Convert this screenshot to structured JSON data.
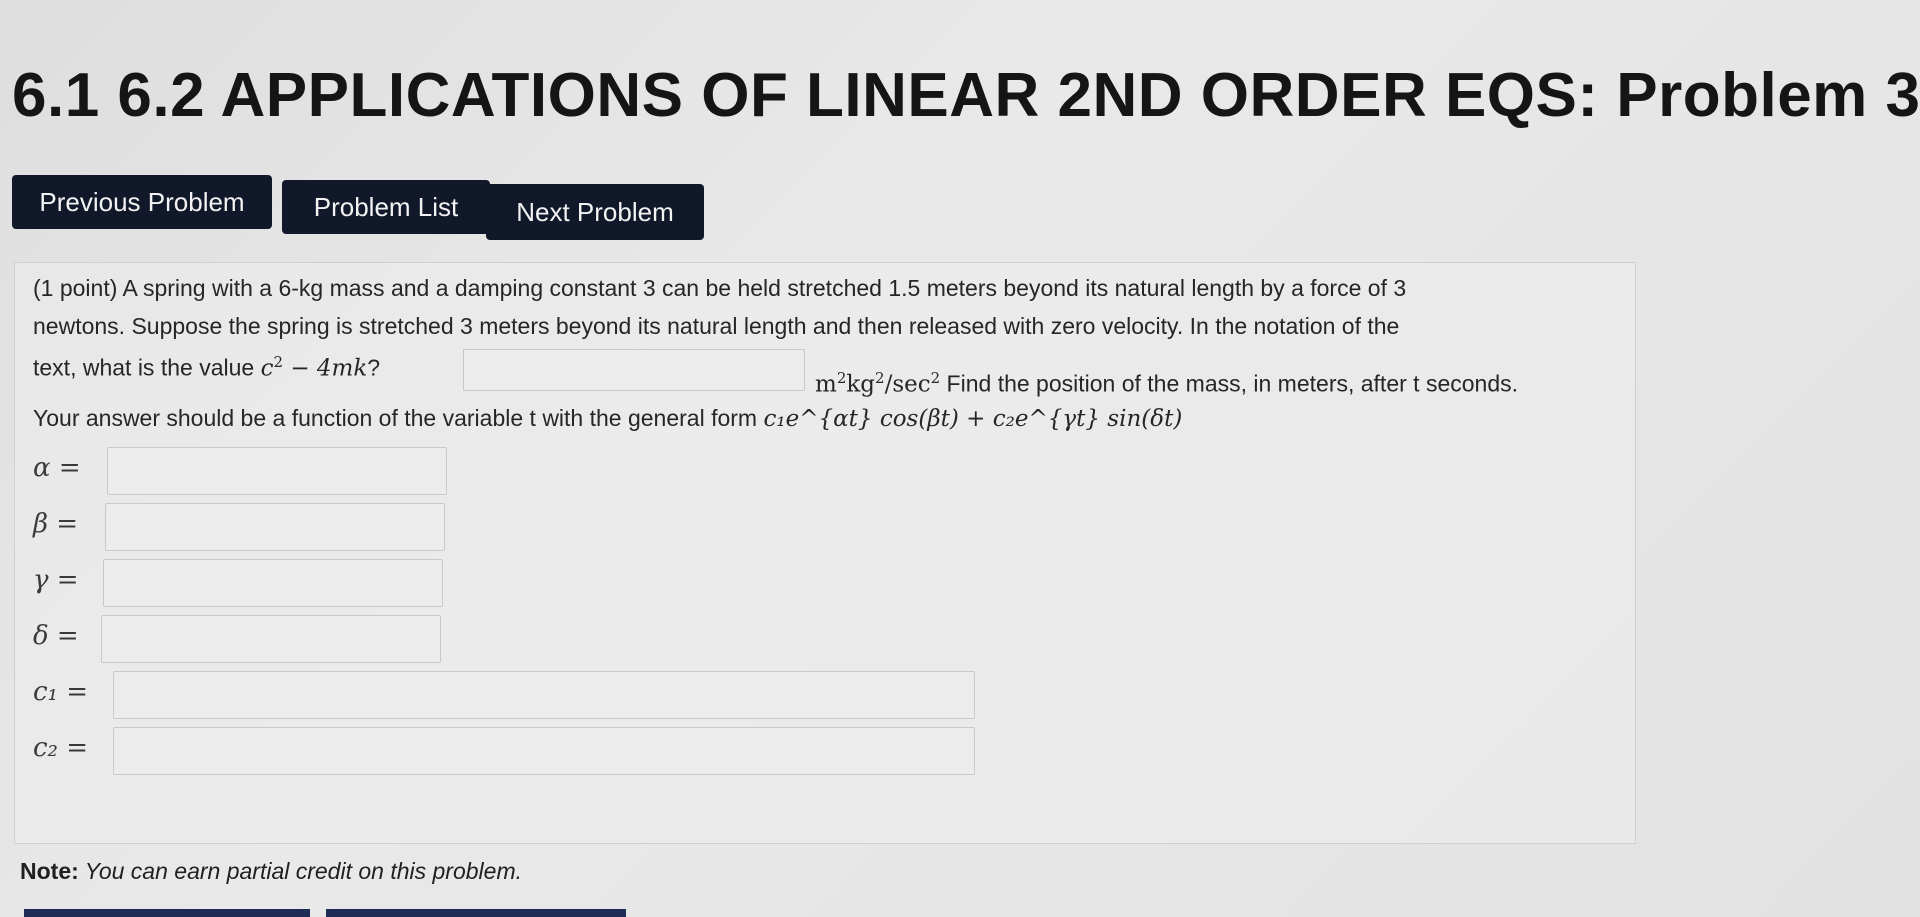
{
  "header": {
    "title": "6.1 6.2 APPLICATIONS OF LINEAR 2ND ORDER EQS: Problem 3"
  },
  "nav": {
    "previous": "Previous Problem",
    "list": "Problem List",
    "next": "Next Problem"
  },
  "problem": {
    "line1": "(1 point) A spring with a 6-kg mass and a damping constant 3 can be held stretched 1.5 meters beyond its natural length by a force of 3",
    "line2": "newtons. Suppose the spring is stretched 3 meters beyond its natural length and then released with zero velocity. In the notation of the",
    "line3_prefix": "text, what is the value ",
    "expr_c": "c",
    "expr_exp": "2",
    "expr_rest": " − 4mk",
    "question_mark": "?",
    "units_m": "m",
    "units_sup1": "2",
    "units_kg": "kg",
    "units_sup2": "2",
    "units_sec": "/sec",
    "units_sup3": "2",
    "find_text": " Find the position of the mass, in meters, after t seconds.",
    "line4": "Your answer should be a function of the variable t with the general form ",
    "general_form": "c₁e^{αt} cos(βt) + c₂e^{γt} sin(δt)"
  },
  "answers": [
    {
      "label": "α ="
    },
    {
      "label": "β ="
    },
    {
      "label": "γ ="
    },
    {
      "label": "δ ="
    },
    {
      "label": "c₁ ="
    },
    {
      "label": "c₂ ="
    }
  ],
  "note": {
    "prefix": "Note:",
    "text": " You can earn partial credit on this problem."
  }
}
